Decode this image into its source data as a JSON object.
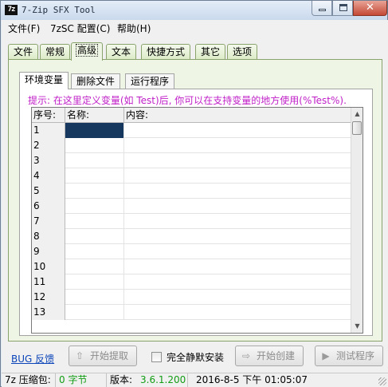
{
  "window": {
    "icon_text": "7z",
    "title": "7-Zip SFX Tool"
  },
  "menu": [
    "文件(F)",
    "7zSC 配置(C)",
    "帮助(H)"
  ],
  "outer_tabs": [
    "文件",
    "常规",
    "高级",
    "文本",
    "快捷方式",
    "其它",
    "选项"
  ],
  "outer_active": "高级",
  "inner_tabs": [
    "环境变量",
    "删除文件",
    "运行程序"
  ],
  "inner_active": "环境变量",
  "tip": "提示: 在这里定义变量(如 Test)后, 你可以在支持变量的地方使用(%Test%).",
  "grid": {
    "headers": [
      "序号:",
      "名称:",
      "内容:"
    ],
    "rows": [
      "1",
      "2",
      "3",
      "4",
      "5",
      "6",
      "7",
      "8",
      "9",
      "10",
      "11",
      "12",
      "13"
    ],
    "selected_row": "1"
  },
  "bottom": {
    "bug_link": "BUG 反馈",
    "extract_button": "开始提取",
    "silent_install_label": "完全静默安装",
    "silent_install_checked": false,
    "create_button": "开始创建",
    "test_button": "测试程序"
  },
  "status": {
    "archive_label": "7z 压缩包:",
    "archive_size": "0 字节",
    "version_label": "版本:",
    "version_value": "3.6.1.200",
    "datetime": "2016-8-5 下午 01:05:07"
  },
  "colors": {
    "tip": "#c01fc8",
    "selection": "#16375e",
    "status_green": "#119d13",
    "link": "#0a44b8"
  }
}
